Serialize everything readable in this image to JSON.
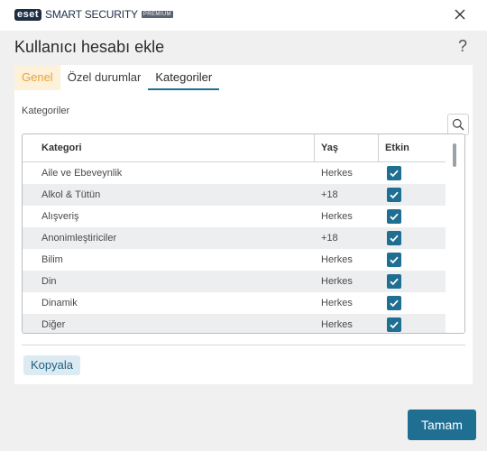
{
  "titlebar": {
    "brand": "eset",
    "product": "SMART SECURITY",
    "edition": "PREMIUM",
    "close_icon": "close-icon"
  },
  "header": {
    "title": "Kullanıcı hesabı ekle",
    "help": "?"
  },
  "tabs": [
    {
      "label": "Genel"
    },
    {
      "label": "Özel durumlar"
    },
    {
      "label": "Kategoriler"
    }
  ],
  "active_tab": "Kategoriler",
  "section_label": "Kategoriler",
  "table": {
    "headers": [
      "Kategori",
      "Yaş",
      "Etkin"
    ],
    "rows": [
      {
        "kategori": "Aile ve Ebeveynlik",
        "yas": "Herkes",
        "etkin": true
      },
      {
        "kategori": "Alkol & Tütün",
        "yas": "+18",
        "etkin": true
      },
      {
        "kategori": "Alışveriş",
        "yas": "Herkes",
        "etkin": true
      },
      {
        "kategori": "Anonimleştiriciler",
        "yas": "+18",
        "etkin": true
      },
      {
        "kategori": "Bilim",
        "yas": "Herkes",
        "etkin": true
      },
      {
        "kategori": "Din",
        "yas": "Herkes",
        "etkin": true
      },
      {
        "kategori": "Dinamik",
        "yas": "Herkes",
        "etkin": true
      },
      {
        "kategori": "Diğer",
        "yas": "Herkes",
        "etkin": true
      }
    ]
  },
  "buttons": {
    "copy": "Kopyala",
    "ok": "Tamam"
  },
  "colors": {
    "accent": "#1f6f93",
    "tab_highlight": "#e8a33a",
    "row_alt": "#eceeef"
  }
}
